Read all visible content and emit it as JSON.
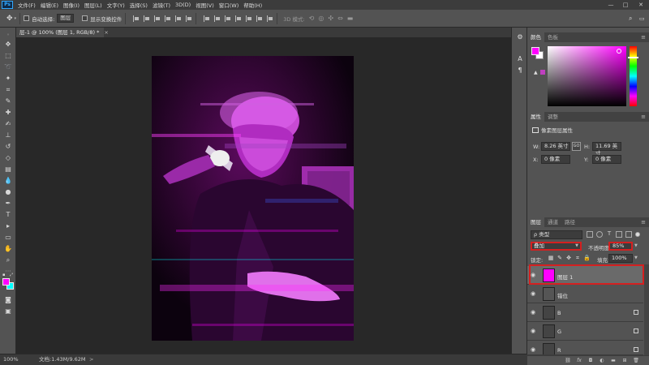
{
  "menubar": {
    "logo": "Ps",
    "items": [
      "文件(F)",
      "编辑(E)",
      "图像(I)",
      "图层(L)",
      "文字(Y)",
      "选择(S)",
      "滤镜(T)",
      "3D(D)",
      "视图(V)",
      "窗口(W)",
      "帮助(H)"
    ],
    "minimize": "—",
    "maximize": "□",
    "close": "✕"
  },
  "options": {
    "auto_select_label": "自动选择:",
    "auto_select_value": "图层",
    "show_transform_label": "显示变换控件",
    "mode_3d_label": "3D 模式:"
  },
  "document": {
    "tab_title": "层-1 @ 100% (图层 1, RGB/8) *",
    "close": "×"
  },
  "status": {
    "zoom": "100%",
    "doc_size": "文档:1.43M/9.62M",
    "arrow": ">"
  },
  "color_panel": {
    "tabs": [
      "颜色",
      "色板"
    ],
    "active_tab": 0,
    "foreground": "#ff00ff",
    "background": "#ffffff",
    "warning_glyph": "▲"
  },
  "properties_panel": {
    "tabs": [
      "属性",
      "调整"
    ],
    "active_tab": 0,
    "kind": "像素图层属性",
    "w_label": "W:",
    "w_value": "8.26 英寸",
    "link_glyph": "GO",
    "h_label": "H:",
    "h_value": "11.69 英寸",
    "x_label": "X:",
    "x_value": "0 像素",
    "y_label": "Y:",
    "y_value": "0 像素"
  },
  "layers_panel": {
    "tabs": [
      "图层",
      "通道",
      "路径"
    ],
    "active_tab": 0,
    "filter_kind": "ρ 类型",
    "blend_mode": "叠加",
    "opacity_label": "不透明度:",
    "opacity_value": "85%",
    "lock_label": "锁定:",
    "fill_label": "填充:",
    "fill_value": "100%",
    "layers": [
      {
        "name": "图层 1",
        "thumb_color": "#ff00ff",
        "selected": true,
        "has_fx": false
      },
      {
        "name": "错位",
        "thumb_color": "#555555",
        "selected": false,
        "has_fx": false
      },
      {
        "name": "B",
        "thumb_color": "#444444",
        "selected": false,
        "has_fx": true
      },
      {
        "name": "G",
        "thumb_color": "#444444",
        "selected": false,
        "has_fx": true
      },
      {
        "name": "R",
        "thumb_color": "#444444",
        "selected": false,
        "has_fx": true
      }
    ],
    "footer_icons": [
      "link-icon",
      "fx-icon",
      "mask-icon",
      "adjustment-icon",
      "group-icon",
      "new-layer-icon",
      "trash-icon"
    ]
  },
  "accent": {
    "highlight_red": "#d42020",
    "panel_bg": "#535353",
    "canvas_bg": "#282828"
  }
}
